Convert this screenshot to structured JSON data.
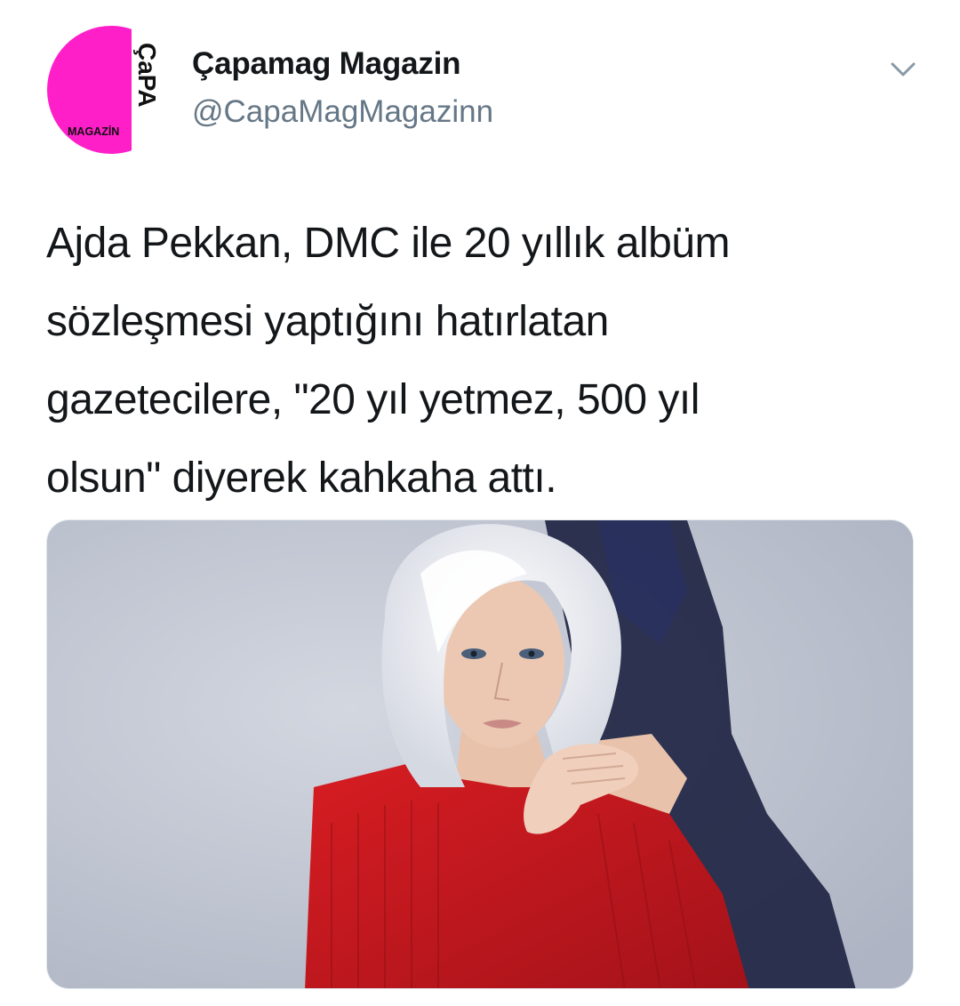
{
  "tweet": {
    "author": {
      "display_name": "Çapamag Magazin",
      "handle": "@CapaMagMagazinn",
      "avatar": {
        "icon": "capa-magazin-logo",
        "logo_text_main": "ÇaPA",
        "logo_text_sub": "MAGAZİN",
        "color": "#ff1fc9"
      }
    },
    "menu_icon": "chevron-down-icon",
    "text": "Ajda Pekkan, DMC ile 20 yıllık albüm\nsözleşmesi yaptığını hatırlatan\ngazetecilere, \"20 yıl yetmez, 500 yıl\nolsun\" diyerek kahkaha attı.",
    "media": {
      "type": "photo",
      "colors": {
        "background": "#c6cbd6",
        "shadow": "#1c2140",
        "sweater": "#c8181c",
        "hair": "#eef0f4",
        "skin": "#e9c2ab"
      }
    }
  }
}
